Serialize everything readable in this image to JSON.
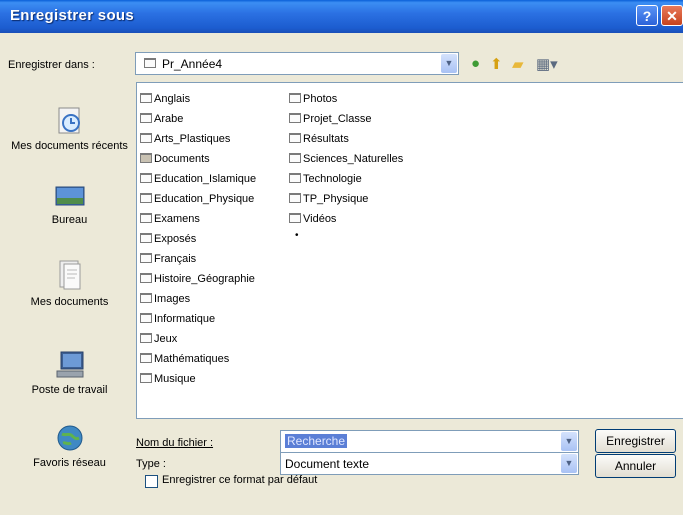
{
  "window": {
    "title": "Enregistrer sous"
  },
  "save_in": {
    "label": "Enregistrer dans :",
    "value": "Pr_Année4"
  },
  "places": [
    {
      "label": "Mes documents récents",
      "icon": "recent-documents-icon"
    },
    {
      "label": "Bureau",
      "icon": "desktop-icon"
    },
    {
      "label": "Mes documents",
      "icon": "my-documents-icon"
    },
    {
      "label": "Poste de travail",
      "icon": "my-computer-icon"
    },
    {
      "label": "Favoris réseau",
      "icon": "network-places-icon"
    }
  ],
  "folders_col1": [
    "Anglais",
    "Arabe",
    "Arts_Plastiques",
    "Documents",
    "Education_Islamique",
    "Education_Physique",
    "Examens",
    "Exposés",
    "Français",
    "Histoire_Géographie",
    "Images",
    "Informatique",
    "Jeux",
    "Mathématiques",
    "Musique"
  ],
  "folders_col2": [
    "Photos",
    "Projet_Classe",
    "Résultats",
    "Sciences_Naturelles",
    "Technologie",
    "TP_Physique",
    "Vidéos"
  ],
  "file_name": {
    "label": "Nom du fichier :",
    "value": "Recherche"
  },
  "file_type": {
    "label": "Type :",
    "value": "Document texte"
  },
  "buttons": {
    "save": "Enregistrer",
    "cancel": "Annuler"
  },
  "default_format": {
    "label": "Enregistrer ce format par défaut",
    "checked": false
  },
  "colors": {
    "titlebar": "#2b71e3",
    "dialog": "#ece9d8",
    "selection": "#5b7fd6"
  }
}
